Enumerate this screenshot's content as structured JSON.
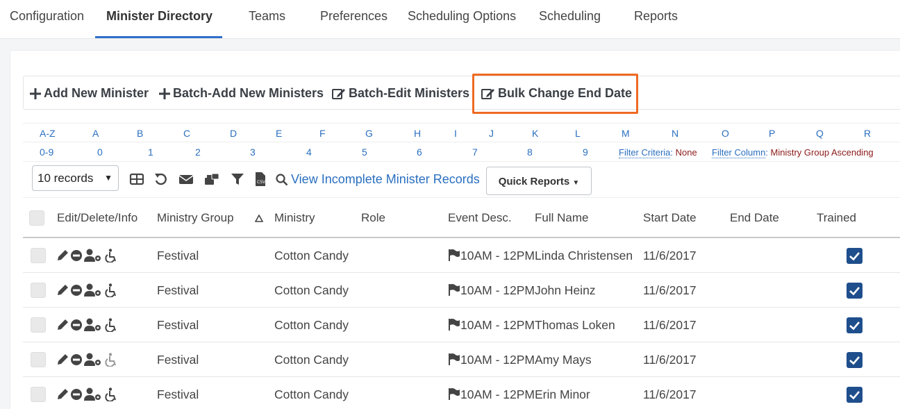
{
  "nav": {
    "tabs": [
      {
        "label": "Configuration"
      },
      {
        "label": "Minister Directory"
      },
      {
        "label": "Teams"
      },
      {
        "label": "Preferences"
      },
      {
        "label": "Scheduling Options"
      },
      {
        "label": "Scheduling"
      },
      {
        "label": "Reports"
      }
    ]
  },
  "toolbar": {
    "add_new": "Add New Minister",
    "batch_add": "Batch-Add New Ministers",
    "batch_edit": "Batch-Edit Ministers",
    "bulk_change": "Bulk Change End Date",
    "highlight_color": "#ef6a22"
  },
  "alpha_filter": [
    "A-Z",
    "A",
    "B",
    "C",
    "D",
    "E",
    "F",
    "G",
    "H",
    "I",
    "J",
    "K",
    "L",
    "M",
    "N",
    "O",
    "P",
    "Q",
    "R"
  ],
  "num_filter": [
    "0-9",
    "0",
    "1",
    "2",
    "3",
    "4",
    "5",
    "6",
    "7",
    "8",
    "9"
  ],
  "filter_criteria": {
    "label": "Filter Criteria",
    "value": "None"
  },
  "filter_column": {
    "label": "Filter Column",
    "value": "Ministry Group Ascending"
  },
  "controls": {
    "records_select": "10 records",
    "icons": [
      "grid-icon",
      "undo-icon",
      "email-icon",
      "print-email-icon",
      "filter-icon",
      "csv-icon"
    ],
    "incomplete_link": "View Incomplete Minister Records",
    "quick_reports": "Quick Reports"
  },
  "table": {
    "headers": {
      "actions": "Edit/Delete/Info",
      "ministry_group": "Ministry Group",
      "ministry": "Ministry",
      "role": "Role",
      "event": "Event Desc.",
      "full_name": "Full Name",
      "start_date": "Start Date",
      "end_date": "End Date",
      "trained": "Trained"
    },
    "rows": [
      {
        "group": "Festival",
        "ministry": "Cotton Candy",
        "role": "",
        "event": "10AM - 12PM",
        "name": "Linda Christensen",
        "start": "11/6/2017",
        "end": "",
        "trained": true
      },
      {
        "group": "Festival",
        "ministry": "Cotton Candy",
        "role": "",
        "event": "10AM - 12PM",
        "name": "John Heinz",
        "start": "11/6/2017",
        "end": "",
        "trained": true
      },
      {
        "group": "Festival",
        "ministry": "Cotton Candy",
        "role": "",
        "event": "10AM - 12PM",
        "name": "Thomas Loken",
        "start": "11/6/2017",
        "end": "",
        "trained": true
      },
      {
        "group": "Festival",
        "ministry": "Cotton Candy",
        "role": "",
        "event": "10AM - 12PM",
        "name": "Amy Mays",
        "start": "11/6/2017",
        "end": "",
        "trained": true
      },
      {
        "group": "Festival",
        "ministry": "Cotton Candy",
        "role": "",
        "event": "10AM - 12PM",
        "name": "Erin Minor",
        "start": "11/6/2017",
        "end": "",
        "trained": true
      }
    ]
  }
}
